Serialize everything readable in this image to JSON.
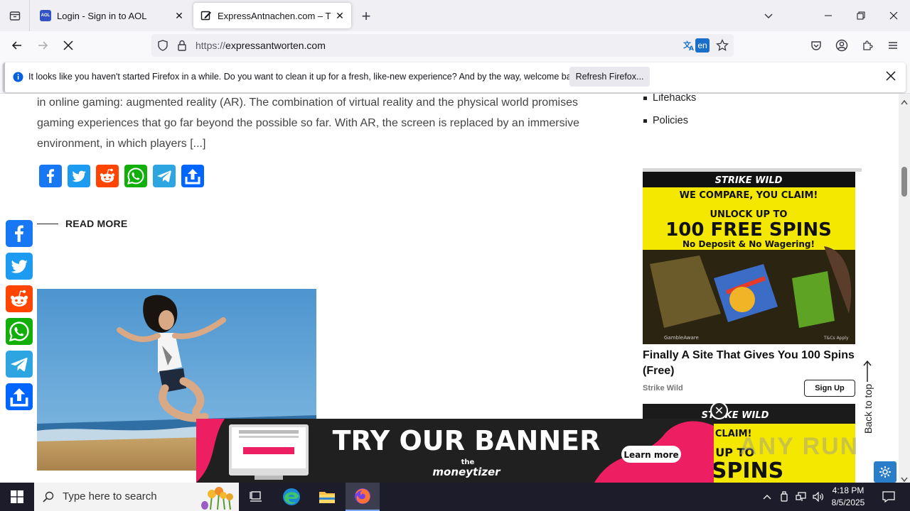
{
  "browser": {
    "tabs": [
      {
        "title": "Login - Sign in to AOL",
        "favicon_text": "AOL",
        "active": false
      },
      {
        "title": "ExpressAntnachen.com – The m",
        "active": true
      }
    ],
    "url": {
      "scheme": "https://",
      "host": "expressantworten.com"
    },
    "translate_badge": "en"
  },
  "notification": {
    "message": "It looks like you haven't started Firefox in a while. Do you want to clean it up for a fresh, like-new experience? And by the way, welcome back!",
    "button": "Refresh Firefox..."
  },
  "article": {
    "lines": [
      "in online gaming: augmented reality (AR). The combination of virtual reality and the physical world promises",
      "gaming experiences that go far beyond the possible so far. With AR, the screen is replaced by an immersive",
      "environment, in which players [...]"
    ],
    "read_more": "READ MORE",
    "share_services": [
      "Facebook",
      "Twitter",
      "Reddit",
      "WhatsApp",
      "Telegram",
      "Share"
    ]
  },
  "sidebar": {
    "items": [
      "Lifehacks",
      "Policies"
    ]
  },
  "ad": {
    "brand_logo": "STRIKE WILD",
    "headline1": "WE COMPARE, YOU CLAIM!",
    "headline2": "UNLOCK UP TO",
    "headline3": "100 FREE SPINS",
    "headline4": "No Deposit & No Wagering!",
    "footer_left": "GambleAware",
    "footer_right": "T&Cs Apply",
    "title": "Finally A Site That Gives You 100 Spins (Free)",
    "source": "Strike Wild",
    "cta": "Sign Up",
    "second_line1": "COMPARE, YOU CLAIM!",
    "second_line2": "UNLOCK UP TO",
    "second_line3": "FREE SPINS"
  },
  "back_to_top": "Back to top",
  "banner": {
    "headline": "TRY OUR BANNER",
    "cta": "Learn more",
    "brand_top": "the",
    "brand": "moneytizer"
  },
  "watermark": "ANY RUN",
  "taskbar": {
    "search_placeholder": "Type here to search",
    "time": "4:18 PM",
    "date": "8/5/2025"
  },
  "colors": {
    "facebook": "#1877f2",
    "twitter": "#1d9bf0",
    "reddit": "#ff4500",
    "whatsapp": "#12af0a",
    "telegram": "#2ca5e0",
    "share": "#0166ff",
    "ad_yellow": "#f4e700",
    "banner_pink": "#ee1e63"
  }
}
